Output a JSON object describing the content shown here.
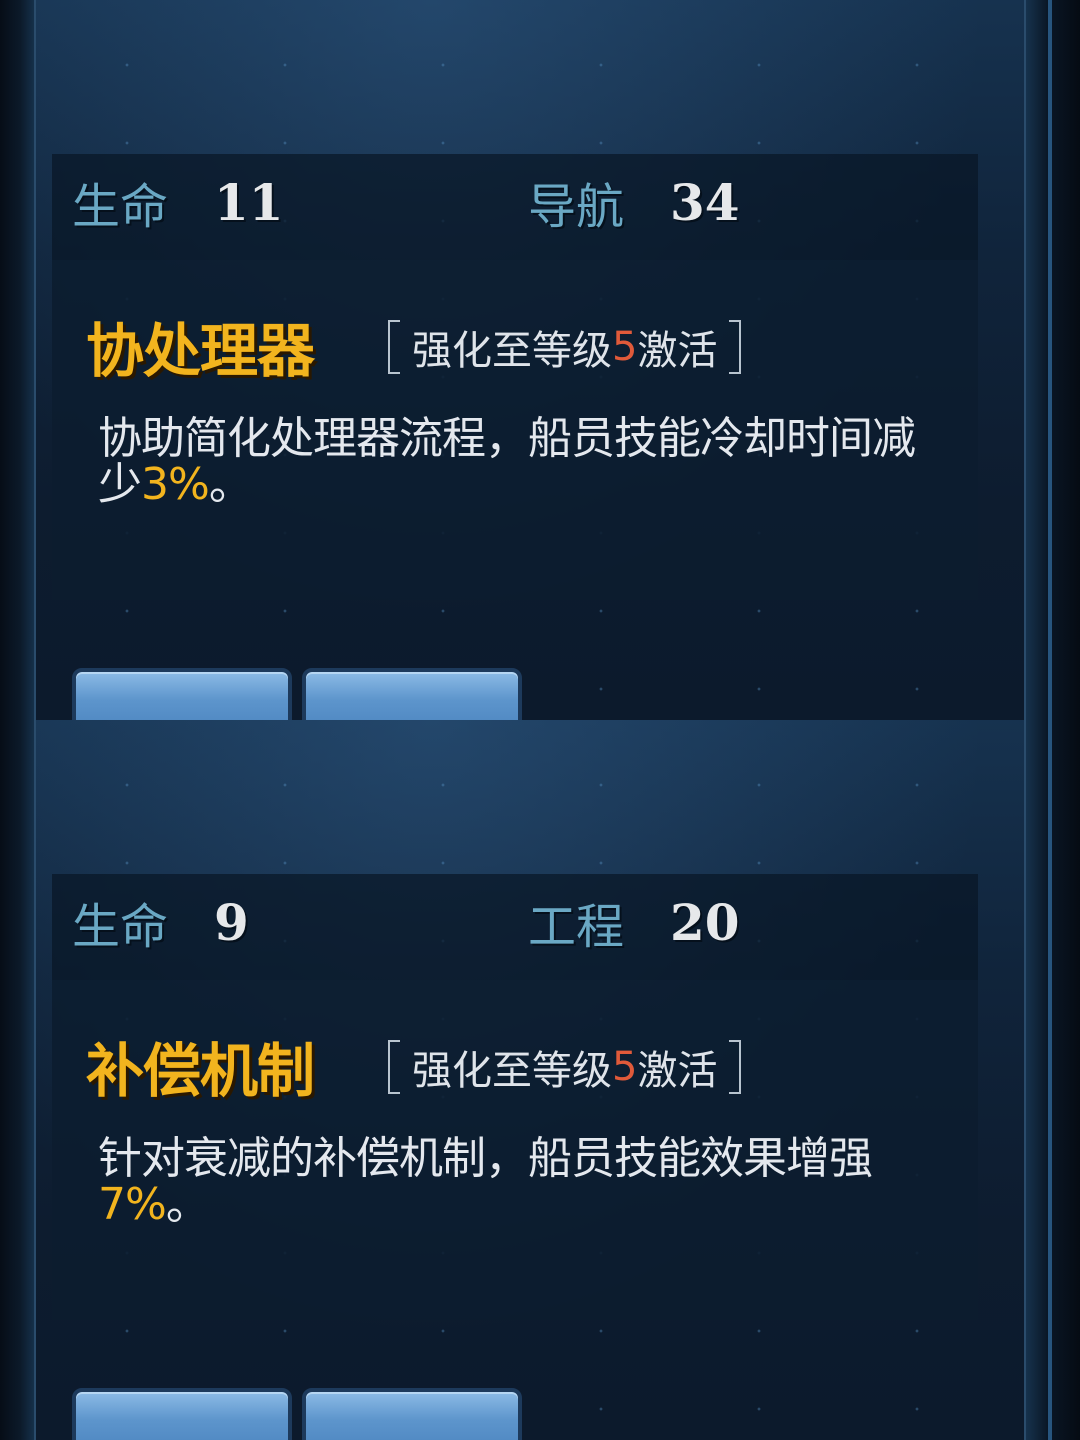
{
  "panels": [
    {
      "stat1": {
        "label": "生命",
        "value": "11"
      },
      "stat2": {
        "label": "导航",
        "value": "34"
      },
      "title": "协处理器",
      "requirement": {
        "prefix": "强化至等级",
        "level": "5",
        "suffix": "激活"
      },
      "description": {
        "text": "协助简化处理器流程，船员技能冷却时间减少",
        "percent": "3%",
        "end": "。"
      }
    },
    {
      "stat1": {
        "label": "生命",
        "value": "9"
      },
      "stat2": {
        "label": "工程",
        "value": "20"
      },
      "title": "补偿机制",
      "requirement": {
        "prefix": "强化至等级",
        "level": "5",
        "suffix": "激活"
      },
      "description": {
        "text": "针对衰减的补偿机制，船员技能效果增强",
        "percent": "7%",
        "end": "。"
      }
    }
  ],
  "colors": {
    "title": "#f2b41e",
    "level": "#e05a3a",
    "stat_label": "#6aa8c4"
  }
}
